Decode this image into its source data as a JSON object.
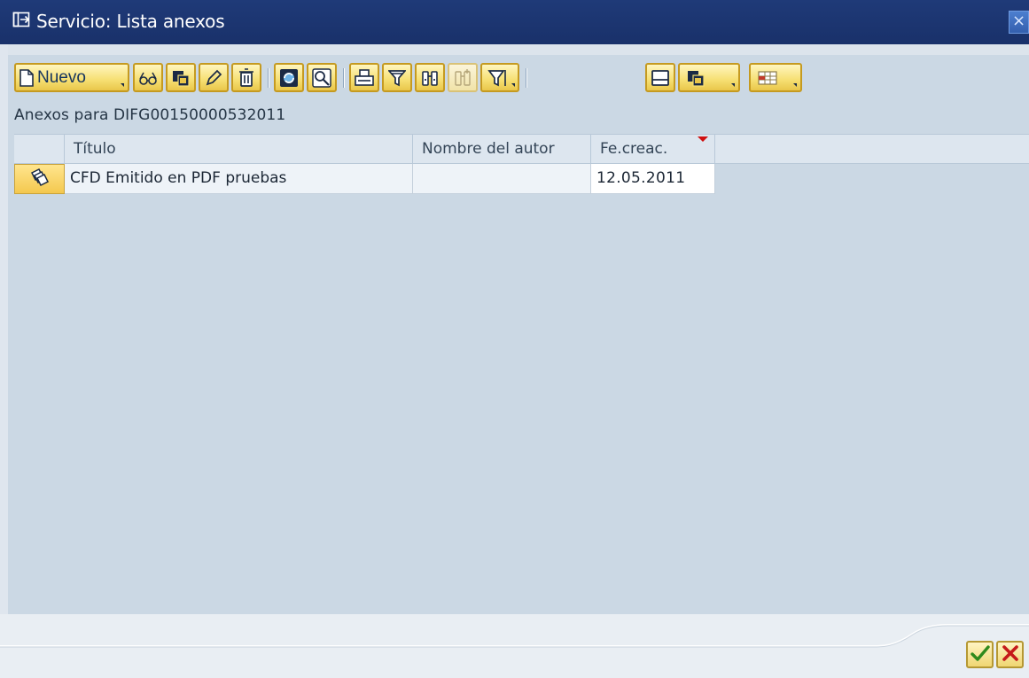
{
  "window": {
    "title": "Servicio: Lista anexos",
    "close_label": "×"
  },
  "toolbar": {
    "new_label": "Nuevo",
    "buttons": [
      "new-button",
      "display-button",
      "copy-button",
      "edit-button",
      "delete-button",
      "refresh-button",
      "zoom-button",
      "print-button",
      "filter-button",
      "find-button",
      "find-next-button",
      "set-filter-button",
      "print-preview-button",
      "export-button",
      "layout-button"
    ]
  },
  "main": {
    "heading": "Anexos para DIFG00150000532011",
    "table": {
      "columns": [
        "Título",
        "Nombre del autor",
        "Fe.creac."
      ],
      "rows": [
        {
          "titulo": "CFD Emitido en PDF pruebas",
          "autor": "",
          "fecha": "12.05.2011"
        }
      ],
      "sorted_column": "Fe.creac.",
      "sort_color": "#d01010"
    }
  },
  "footer": {
    "ok_icon": "checkmark-icon",
    "cancel_icon": "x-icon"
  },
  "colors": {
    "titlebar": "#1f3a78",
    "frame": "#cbd8e4",
    "button_yellow": "#f6df72"
  }
}
